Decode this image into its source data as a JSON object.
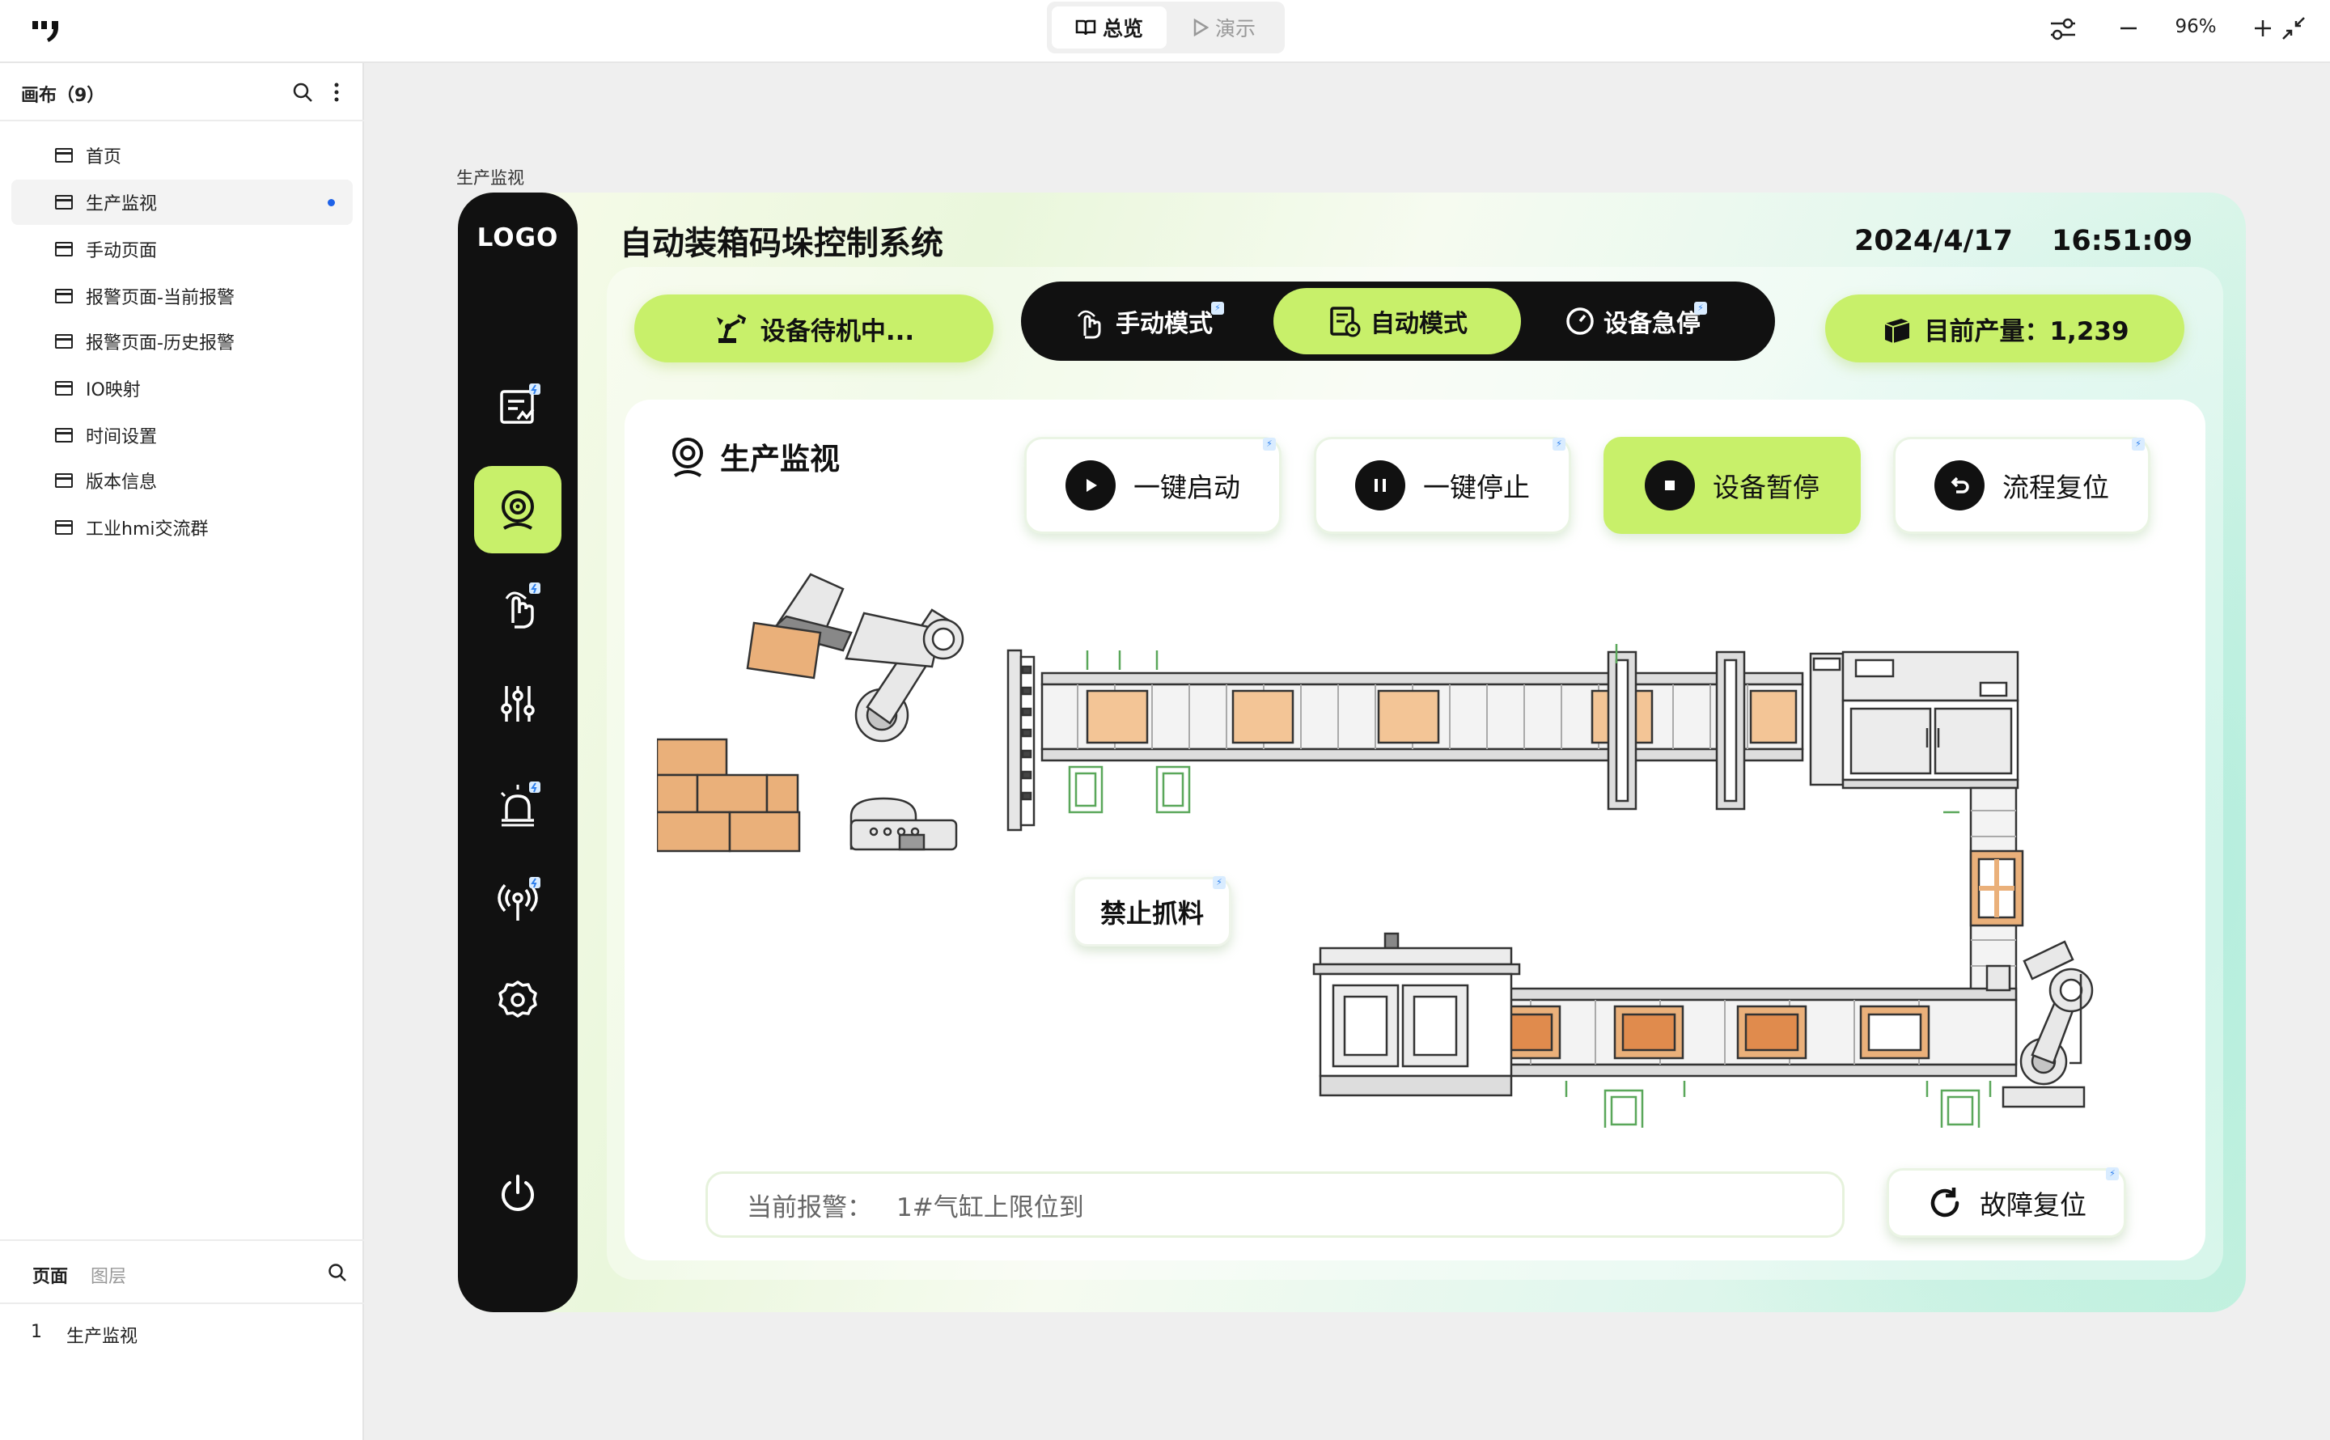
{
  "toolbar": {
    "overview_label": "总览",
    "demo_label": "演示",
    "zoom": "96%"
  },
  "sidebar": {
    "title": "画布（9）",
    "pages": [
      {
        "label": "首页"
      },
      {
        "label": "生产监视",
        "active": true
      },
      {
        "label": "手动页面"
      },
      {
        "label": "报警页面-当前报警"
      },
      {
        "label": "报警页面-历史报警"
      },
      {
        "label": "IO映射"
      },
      {
        "label": "时间设置"
      },
      {
        "label": "版本信息"
      },
      {
        "label": "工业hmi交流群"
      }
    ],
    "tabs": {
      "pages": "页面",
      "layers": "图层"
    },
    "layers": [
      {
        "index": "1",
        "label": "生产监视"
      }
    ]
  },
  "canvas": {
    "frame_label": "生产监视"
  },
  "hmi": {
    "logo": "LOGO",
    "title": "自动装箱码垛控制系统",
    "date": "2024/4/17",
    "time": "16:51:09",
    "status": "设备待机中...",
    "modes": {
      "manual": "手动模式",
      "auto": "自动模式",
      "estop": "设备急停"
    },
    "output": "目前产量：1,239",
    "section_title": "生产监视",
    "controls": {
      "start": "一键启动",
      "stop": "一键停止",
      "pause": "设备暂停",
      "reset": "流程复位"
    },
    "no_grab": "禁止抓料",
    "alarm_label": "当前报警：",
    "alarm_text": "1#气缸上限位到",
    "fault_reset": "故障复位"
  },
  "colors": {
    "accent": "#c8f06a",
    "dark": "#111111",
    "box": "#f0b27a",
    "active_dot": "#1e62e8"
  }
}
